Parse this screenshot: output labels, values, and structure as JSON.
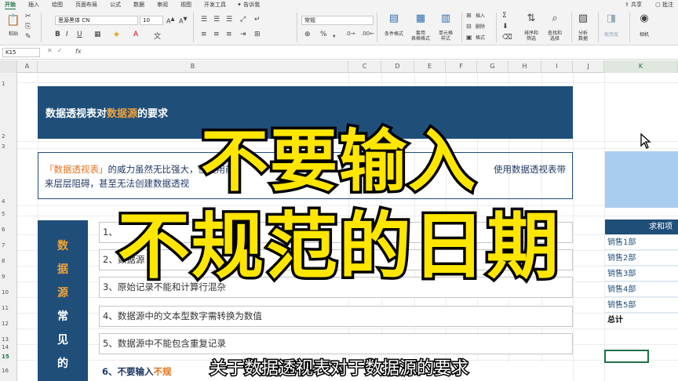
{
  "ribbon": {
    "tabs": [
      "开始",
      "插入",
      "绘图",
      "页面布局",
      "公式",
      "数据",
      "审阅",
      "视图",
      "开发工具",
      "告诉我"
    ],
    "share": "共享",
    "comment": "批注",
    "paste_label": "粘贴",
    "font_name": "思源黑体 CN",
    "font_size": "10",
    "number_format": "常规",
    "groups": {
      "cond_format": "条件格式",
      "table_format": "套用\n表格格式",
      "cell_style": "单元格\n样式",
      "insert": "插入",
      "delete": "删除",
      "format": "格式",
      "sort_filter": "排序和\n筛选",
      "find_select": "查找和\n选择",
      "analyze": "分析\n数据",
      "sensitivity": "敏感度",
      "camera": "相机"
    }
  },
  "formula_bar": {
    "name_box": "K15",
    "fx": "fx"
  },
  "grid": {
    "columns": [
      "A",
      "B",
      "C",
      "D",
      "E",
      "F",
      "G",
      "H",
      "I",
      "J",
      "K"
    ],
    "rows": [
      "1",
      "2",
      "3",
      "4",
      "5",
      "6",
      "7",
      "8",
      "9",
      "10",
      "11",
      "12",
      "13",
      "14",
      "15",
      "16"
    ]
  },
  "sheet": {
    "title_prefix": "数据透视表对",
    "title_highlight": "数据源",
    "title_suffix": "的要求",
    "intro_quote": "「数据透视表」",
    "intro_line1": "的威力虽然无比强大，但使用前",
    "intro_line1_end": "使用数据透视表带",
    "intro_line2": "来层层阻碍，甚至无法创建数据透视",
    "sidebar_chars": [
      "数",
      "据",
      "源",
      "常",
      "见",
      "的"
    ],
    "list": [
      "1、",
      "2、数据源",
      "3、原始记录不能和计算行混杂",
      "4、数据源中的文本型数字需转换为数值",
      "5、数据源中不能包含重复记录"
    ],
    "item6_prefix": "6、不要输入",
    "item6_orange": "不规",
    "right_header": "求和项",
    "right_rows": [
      "销售1部",
      "销售2部",
      "销售3部",
      "销售4部",
      "销售5部"
    ],
    "right_total": "总计"
  },
  "overlay": {
    "line1": "不要输入",
    "line2": "不规范的日期",
    "subtitle": "关于数据透视表对于数据源的要求"
  },
  "colors": {
    "excel_green": "#1e7145",
    "navy": "#1f4e79",
    "orange": "#e2711d",
    "caption_yellow": "#ffe600",
    "panel_blue": "#a9cdef"
  }
}
